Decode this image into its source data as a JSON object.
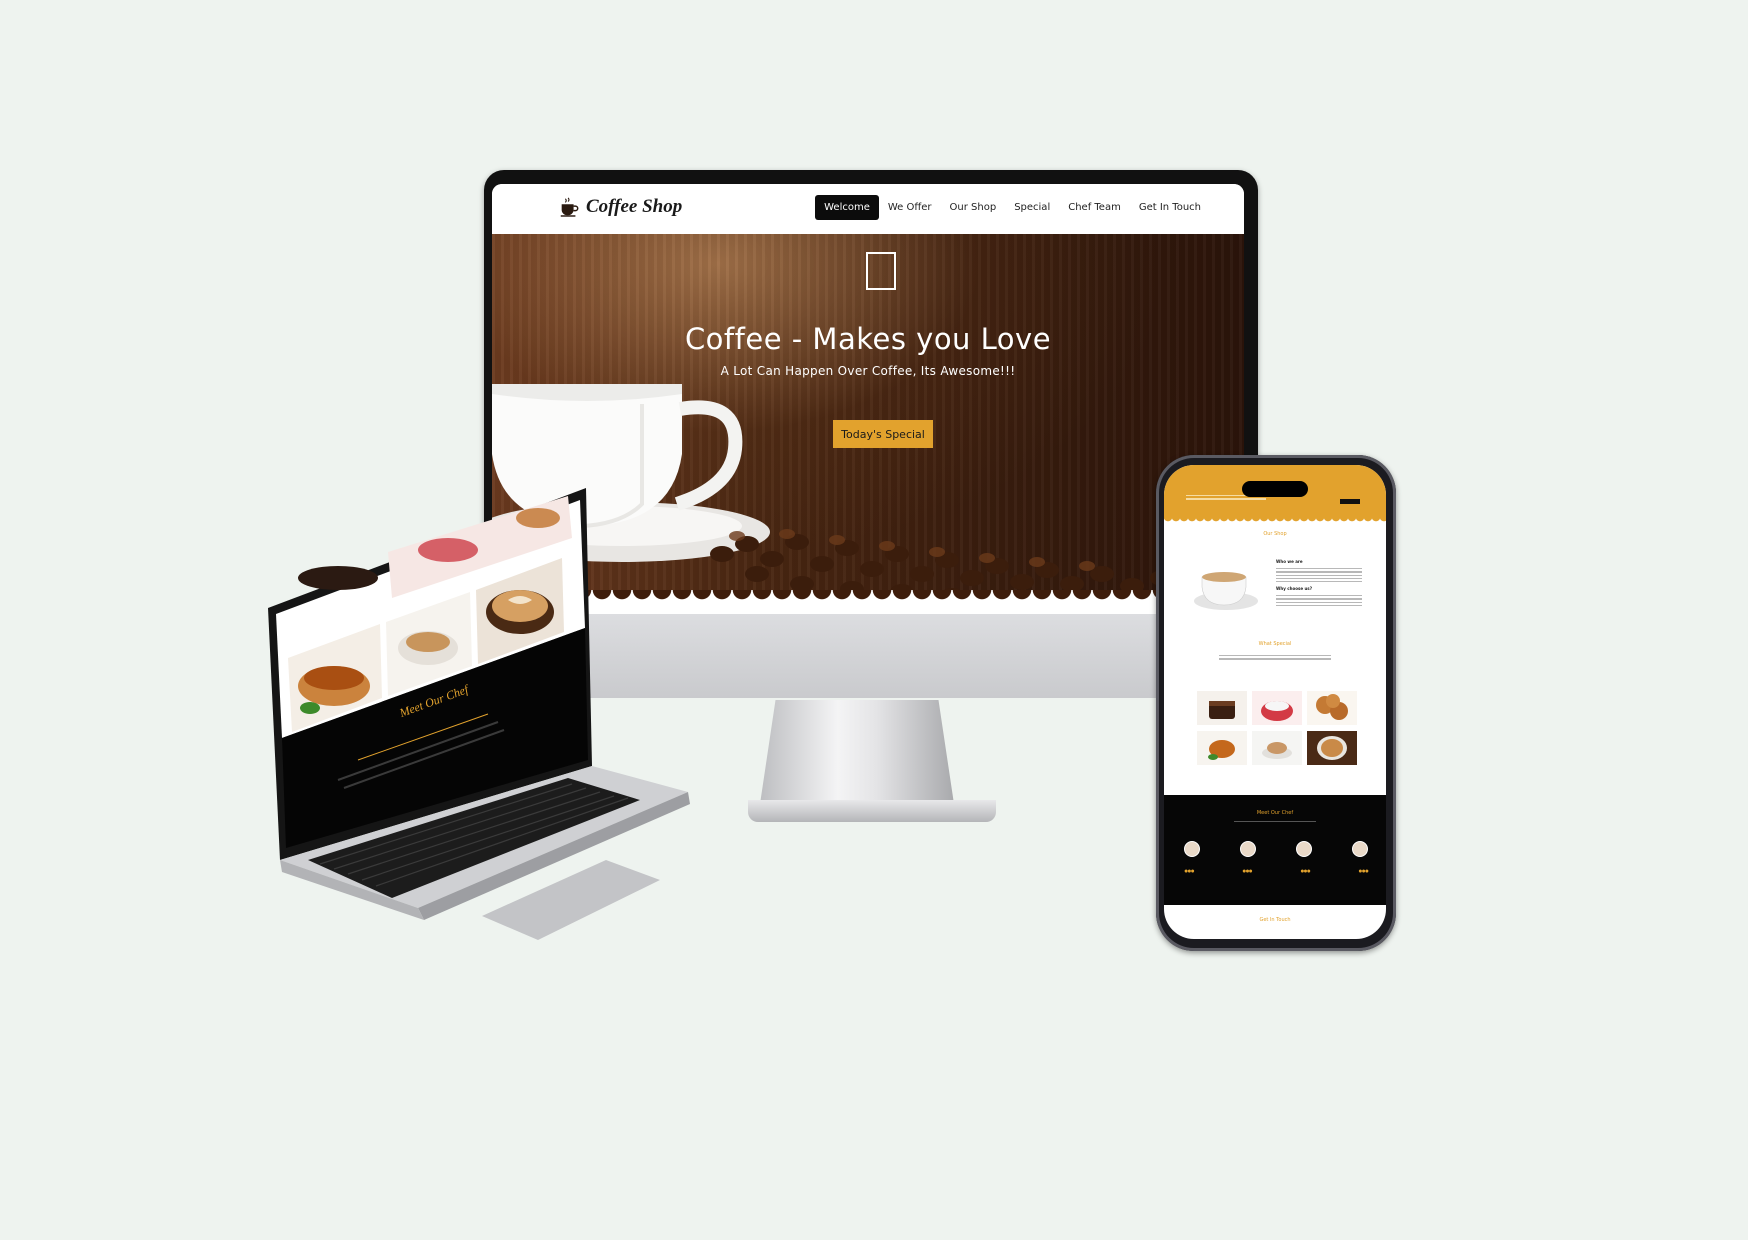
{
  "site": {
    "brand": "Coffee Shop",
    "nav": [
      "Welcome",
      "We Offer",
      "Our Shop",
      "Special",
      "Chef Team",
      "Get In Touch"
    ],
    "active_nav": "Welcome"
  },
  "hero": {
    "title": "Coffee - Makes you Love",
    "subtitle": "A Lot Can Happen Over Coffee, Its Awesome!!!",
    "button": "Today's Special"
  },
  "laptop": {
    "section_title": "Meet Our Chef"
  },
  "phone": {
    "sections": {
      "shop": "Our Shop",
      "who_we_are": "Who we are",
      "why_choose": "Why choose us?",
      "special": "What Special",
      "chef": "Meet Our Chef",
      "contact": "Get In Touch"
    }
  },
  "colors": {
    "accent": "#e2a22d",
    "background": "#eef3ef",
    "dark": "#060606",
    "nav_active": "#0c0c0c"
  },
  "icons": [
    "coffee-cup-icon"
  ]
}
